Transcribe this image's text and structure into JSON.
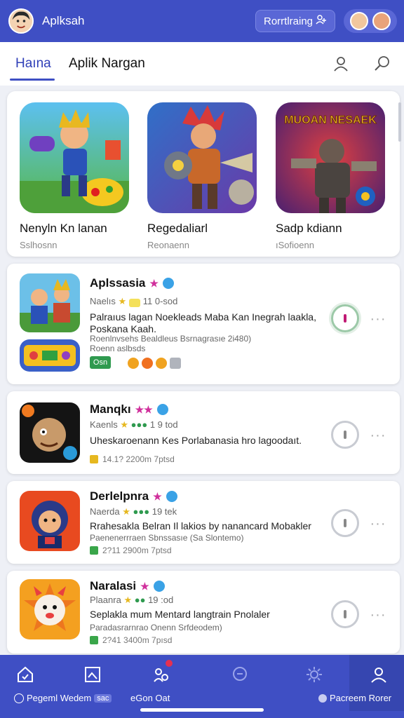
{
  "header": {
    "title": "Aplksah",
    "action_label": "Rorrtlraing",
    "action_icon": "user-add-icon"
  },
  "tabs": [
    {
      "label": "Haına",
      "active": true
    },
    {
      "label": "Aplik Nargan",
      "active": false
    }
  ],
  "featured": [
    {
      "name": "Nenyln Kn lanan",
      "subtitle": "Sslhosnn"
    },
    {
      "name": "Regedaliarl",
      "subtitle": "Reonaenn"
    },
    {
      "name": "Sadp kdiann",
      "subtitle": "ıSofioenn",
      "art_text": "MUOAN NESAEK"
    }
  ],
  "apps": [
    {
      "title": "Aplssasia",
      "meta_prefix": "Naelıs",
      "meta_badge": "",
      "meta_suffix": "11 0-sod",
      "description": "Palraıus lagan Noekleads Maba Kan Inegrah laakla, Poskana Kaah.",
      "extra": "Roenlnvsehs Bealdleus Bsrnagrasıe 2i480)",
      "extra2": "Roenn aslbsds",
      "get_label": "Osn",
      "foot": ""
    },
    {
      "title": "Manqkı",
      "meta_prefix": "Kaenls",
      "meta_suffix": "1 9 tod",
      "description": "Uheskaroenann Kes Porlabanasia hro lagoodaıt.",
      "extra": "",
      "foot": "14.1? 2200m 7ptsd"
    },
    {
      "title": "Derlelpnra",
      "meta_prefix": "Naerda",
      "meta_suffix": "19 tek",
      "description": "Rrahesakla Belran Il lakios by nanancard Mobakler",
      "extra": "Paenenerrraen Sbnssasıe (Sa Slontemo)",
      "foot": "2?11 2900m 7ptsd"
    },
    {
      "title": "Naralasi",
      "meta_prefix": "Plaanra",
      "meta_suffix": "19 :od",
      "description": "Seplakla mum Mentard langtrain Pnolaler",
      "extra": "Paradasrarnrao Onenn Srfdeodem)",
      "foot": "2?41 3400m 7pısd"
    }
  ],
  "bottom_nav": {
    "left_label": "Pegeml Wedem",
    "left_badge": "sac",
    "center_label": "eGon Oat",
    "right_label": "Pacreem Rorer"
  },
  "colors": {
    "brand": "#3f4fc4",
    "accent_star": "#d0309c",
    "verified": "#3aa2e6",
    "success": "#2f9a4f"
  }
}
